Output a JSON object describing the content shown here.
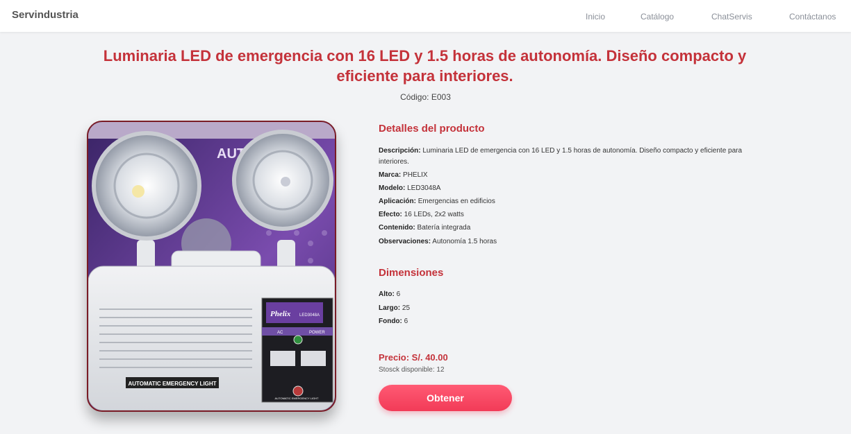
{
  "nav": {
    "brand": "Servindustria",
    "links": [
      "Inicio",
      "Catálogo",
      "ChatServis",
      "Contáctanos"
    ]
  },
  "product": {
    "title": "Luminaria LED de emergencia con 16 LED y 1.5 horas de autonomía. Diseño compacto y eficiente para interiores.",
    "code_label": "Código:",
    "code": "E003",
    "image_text": {
      "brand_plate": "Phelix",
      "model_plate": "LED3048A",
      "label": "AUTOMATIC EMERGENCY LIGHT",
      "ac": "AC",
      "power": "POWER",
      "bottom_label": "AUTOMATIC EMERGENCY LIGHT",
      "box_text": "AUTO EME LIG"
    }
  },
  "details": {
    "heading": "Detalles del producto",
    "items": [
      {
        "label": "Descripción:",
        "value": "Luminaria LED de emergencia con 16 LED y 1.5 horas de autonomía. Diseño compacto y eficiente para interiores."
      },
      {
        "label": "Marca:",
        "value": "PHELIX"
      },
      {
        "label": "Modelo:",
        "value": "LED3048A"
      },
      {
        "label": "Aplicación:",
        "value": "Emergencias en edificios"
      },
      {
        "label": "Efecto:",
        "value": "16 LEDs, 2x2 watts"
      },
      {
        "label": "Contenido:",
        "value": "Batería integrada"
      },
      {
        "label": "Observaciones:",
        "value": "Autonomía 1.5 horas"
      }
    ]
  },
  "dimensions": {
    "heading": "Dimensiones",
    "items": [
      {
        "label": "Alto:",
        "value": "6"
      },
      {
        "label": "Largo:",
        "value": "25"
      },
      {
        "label": "Fondo:",
        "value": "6"
      }
    ]
  },
  "purchase": {
    "price": "Precio: S/. 40.00",
    "stock": "Stosck disponible: 12",
    "button": "Obtener"
  },
  "colors": {
    "accent": "#c4323a",
    "button": "#f23b57"
  }
}
